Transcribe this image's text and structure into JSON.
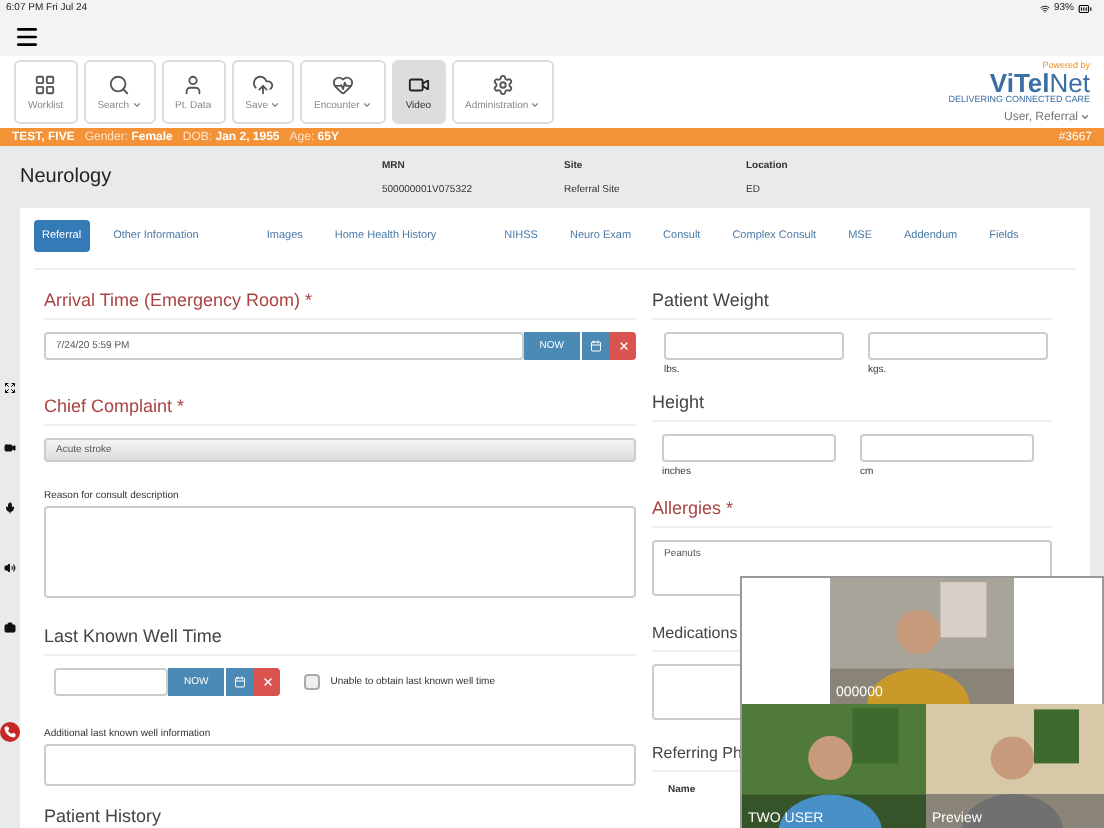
{
  "status_bar": {
    "time": "6:07 PM  Fri Jul 24",
    "battery": "93%"
  },
  "toolbar": [
    {
      "label": "Worklist",
      "dropdown": false,
      "selected": false
    },
    {
      "label": "Search",
      "dropdown": true,
      "selected": false
    },
    {
      "label": "Pt. Data",
      "dropdown": false,
      "selected": false
    },
    {
      "label": "Save",
      "dropdown": true,
      "selected": false
    },
    {
      "label": "Encounter",
      "dropdown": true,
      "selected": false
    },
    {
      "label": "Video",
      "dropdown": false,
      "selected": true
    },
    {
      "label": "Administration",
      "dropdown": true,
      "selected": false
    }
  ],
  "brand": {
    "tagline": "Powered by",
    "name_bold": "ViTel",
    "name_light": "Net",
    "subtitle": "DELIVERING CONNECTED CARE"
  },
  "user_menu": "User, Referral",
  "patient_bar": {
    "name": "TEST, FIVE",
    "fields": [
      {
        "label": "Gender:",
        "value": "Female"
      },
      {
        "label": "DOB:",
        "value": "Jan 2, 1955"
      },
      {
        "label": "Age:",
        "value": "65Y"
      }
    ],
    "id": "#3667"
  },
  "header": {
    "title": "Neurology",
    "fields": [
      {
        "label": "MRN",
        "value": "500000001V075322"
      },
      {
        "label": "Site",
        "value": "Referral Site"
      },
      {
        "label": "Location",
        "value": "ED"
      }
    ]
  },
  "tabs": [
    {
      "label": "Referral",
      "selected": true
    },
    {
      "label": "Other Information",
      "selected": false
    },
    {
      "label": "Images",
      "selected": false
    },
    {
      "label": "Home Health History",
      "selected": false
    },
    {
      "label": "NIHSS",
      "selected": false
    },
    {
      "label": "Neuro Exam",
      "selected": false
    },
    {
      "label": "Consult",
      "selected": false
    },
    {
      "label": "Complex Consult",
      "selected": false
    },
    {
      "label": "MSE",
      "selected": false
    },
    {
      "label": "Addendum",
      "selected": false
    },
    {
      "label": "Fields",
      "selected": false
    }
  ],
  "left_column": {
    "arrival": {
      "title": "Arrival Time (Emergency Room) *",
      "required": true,
      "value": "7/24/20 5:59 PM",
      "now": "NOW"
    },
    "complaint": {
      "title": "Chief Complaint *",
      "required": true,
      "value": "Acute stroke",
      "description_label": "Reason for consult description"
    },
    "last_known_well": {
      "title": "Last Known Well Time",
      "required": false,
      "now": "NOW",
      "checkbox_label": "Unable to obtain last known well time",
      "checked": false,
      "info_label": "Additional last known well information"
    },
    "patient_history": {
      "title": "Patient History"
    }
  },
  "right_column": {
    "weight": {
      "title": "Patient Weight",
      "units": [
        "lbs.",
        "kgs."
      ]
    },
    "height": {
      "title": "Height",
      "units": [
        "inches",
        "cm"
      ]
    },
    "allergies": {
      "title": "Allergies *",
      "required": true,
      "value": "Peanuts"
    },
    "medications": {
      "title": "Medications",
      "required": false
    },
    "referring": {
      "title": "Referring Ph",
      "name_label": "Name"
    }
  },
  "video": {
    "tiles": [
      {
        "label": "000000",
        "kind": "picture"
      },
      {
        "label": "TWO USER",
        "kind": "picture"
      },
      {
        "label": "Preview",
        "kind": "picture"
      }
    ]
  }
}
